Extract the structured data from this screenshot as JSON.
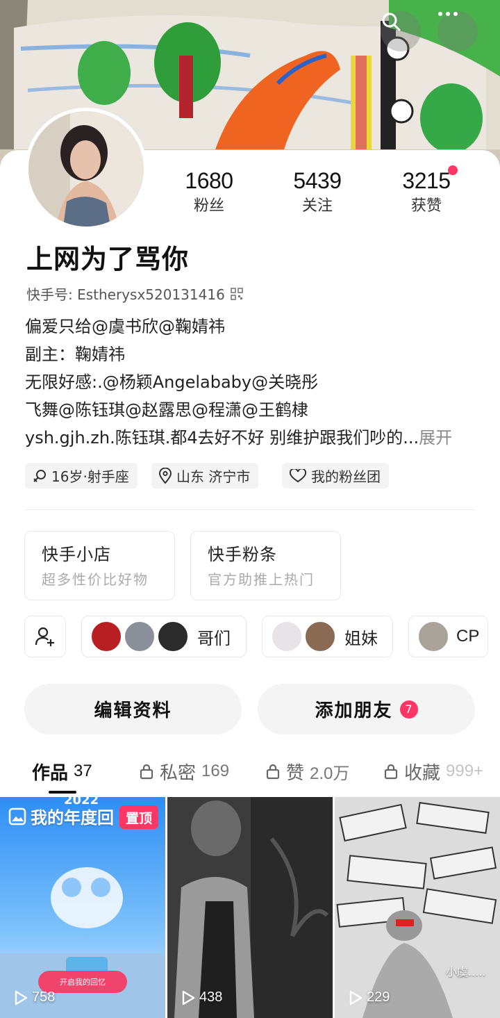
{
  "colors": {
    "accent": "#fe3666",
    "chip_bg": "#f4f4f4",
    "text": "#111111"
  },
  "header": {
    "search_icon": "search-icon",
    "more_icon": "more-icon"
  },
  "stats": [
    {
      "value": "1680",
      "label": "粉丝"
    },
    {
      "value": "5439",
      "label": "关注"
    },
    {
      "value": "3215",
      "label": "获赞"
    }
  ],
  "profile": {
    "nickname": "上网为了骂你",
    "kuaishou_id": "快手号: Estherysx520131416",
    "bio_lines": [
      "偏爱只给@虞书欣@鞠婧祎",
      "副主：鞠婧祎",
      "无限好感:.@杨颖Angelababy@关晓彤",
      "飞舞@陈钰琪@赵露思@程潇@王鹤棣",
      "ysh.gjh.zh.陈钰琪.都4去好不好 别维护跟我们吵的..."
    ],
    "bio_expand": "展开",
    "tags": [
      "16岁·射手座",
      "山东 济宁市",
      "我的粉丝团"
    ]
  },
  "services": [
    {
      "title": "快手小店",
      "subtitle": "超多性价比好物"
    },
    {
      "title": "快手粉条",
      "subtitle": "官方助推上热门"
    }
  ],
  "groups": [
    {
      "label": "哥们"
    },
    {
      "label": "姐妹"
    },
    {
      "label": "CP"
    }
  ],
  "actions": {
    "edit_label": "编辑资料",
    "add_friend_label": "添加朋友",
    "add_friend_badge": "7"
  },
  "tabs": [
    {
      "label": "作品",
      "count": "37"
    },
    {
      "label": "私密",
      "count": "169"
    },
    {
      "label": "赞",
      "count": "2.0万"
    },
    {
      "label": "收藏",
      "count": "999+"
    }
  ],
  "videos": [
    {
      "plays": "758",
      "pinned_label": "置顶",
      "year": "2022",
      "title": "我的年度回",
      "cta": "开启我的回忆"
    },
    {
      "plays": "438"
    },
    {
      "plays": "229",
      "caption": "小虞....."
    }
  ]
}
